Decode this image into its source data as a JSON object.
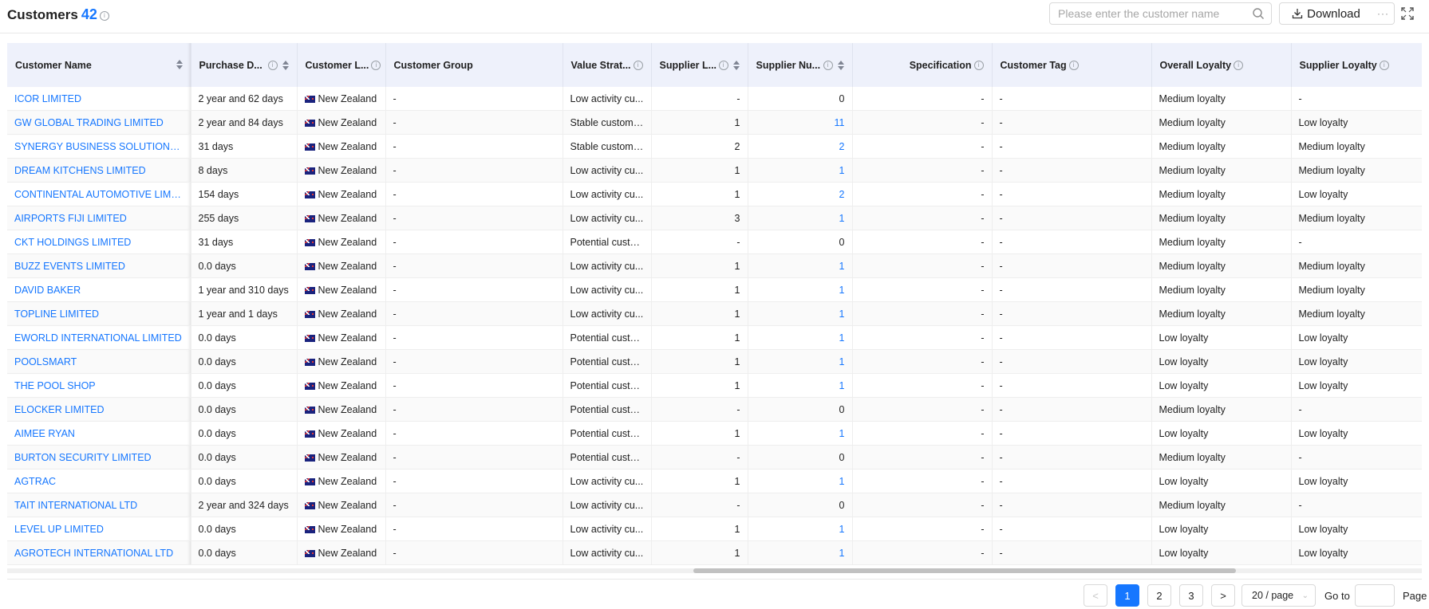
{
  "header": {
    "title": "Customers",
    "count": "42",
    "info_icon": "info-icon",
    "search_placeholder": "Please enter the customer name",
    "download_label": "Download",
    "more_label": "···"
  },
  "columns": [
    {
      "label": "Customer Name",
      "sortable": true,
      "info": false
    },
    {
      "label": "Purchase D...",
      "sortable": true,
      "info": true
    },
    {
      "label": "Customer L...",
      "sortable": false,
      "info": true
    },
    {
      "label": "Customer Group",
      "sortable": false,
      "info": false
    },
    {
      "label": "Value Strat...",
      "sortable": false,
      "info": true
    },
    {
      "label": "Supplier L...",
      "sortable": true,
      "info": true
    },
    {
      "label": "Supplier Nu...",
      "sortable": true,
      "info": true
    },
    {
      "label": "Specification",
      "sortable": false,
      "info": true
    },
    {
      "label": "Customer Tag",
      "sortable": false,
      "info": true
    },
    {
      "label": "Overall Loyalty",
      "sortable": false,
      "info": true
    },
    {
      "label": "Supplier Loyalty",
      "sortable": false,
      "info": true
    }
  ],
  "rows": [
    {
      "name": "ICOR LIMITED",
      "purchase": "2 year and 62 days",
      "location": "New Zealand",
      "group": "-",
      "value": "Low activity cu...",
      "sup_l": "-",
      "sup_n": "0",
      "spec": "-",
      "tag": "-",
      "overall": "Medium loyalty",
      "supplier_loyalty": "-"
    },
    {
      "name": "GW GLOBAL TRADING LIMITED",
      "purchase": "2 year and 84 days",
      "location": "New Zealand",
      "group": "-",
      "value": "Stable customers",
      "sup_l": "1",
      "sup_n": "11",
      "spec": "-",
      "tag": "-",
      "overall": "Medium loyalty",
      "supplier_loyalty": "Low loyalty"
    },
    {
      "name": "SYNERGY BUSINESS SOLUTIONS LIM...",
      "purchase": "31 days",
      "location": "New Zealand",
      "group": "-",
      "value": "Stable customers",
      "sup_l": "2",
      "sup_n": "2",
      "spec": "-",
      "tag": "-",
      "overall": "Medium loyalty",
      "supplier_loyalty": "Medium loyalty"
    },
    {
      "name": "DREAM KITCHENS LIMITED",
      "purchase": "8 days",
      "location": "New Zealand",
      "group": "-",
      "value": "Low activity cu...",
      "sup_l": "1",
      "sup_n": "1",
      "spec": "-",
      "tag": "-",
      "overall": "Medium loyalty",
      "supplier_loyalty": "Medium loyalty"
    },
    {
      "name": "CONTINENTAL AUTOMOTIVE LIMITED",
      "purchase": "154 days",
      "location": "New Zealand",
      "group": "-",
      "value": "Low activity cu...",
      "sup_l": "1",
      "sup_n": "2",
      "spec": "-",
      "tag": "-",
      "overall": "Medium loyalty",
      "supplier_loyalty": "Low loyalty"
    },
    {
      "name": "AIRPORTS FIJI LIMITED",
      "purchase": "255 days",
      "location": "New Zealand",
      "group": "-",
      "value": "Low activity cu...",
      "sup_l": "3",
      "sup_n": "1",
      "spec": "-",
      "tag": "-",
      "overall": "Medium loyalty",
      "supplier_loyalty": "Medium loyalty"
    },
    {
      "name": "CKT HOLDINGS LIMITED",
      "purchase": "31 days",
      "location": "New Zealand",
      "group": "-",
      "value": "Potential custo...",
      "sup_l": "-",
      "sup_n": "0",
      "spec": "-",
      "tag": "-",
      "overall": "Medium loyalty",
      "supplier_loyalty": "-"
    },
    {
      "name": "BUZZ EVENTS LIMITED",
      "purchase": "0.0 days",
      "location": "New Zealand",
      "group": "-",
      "value": "Low activity cu...",
      "sup_l": "1",
      "sup_n": "1",
      "spec": "-",
      "tag": "-",
      "overall": "Medium loyalty",
      "supplier_loyalty": "Medium loyalty"
    },
    {
      "name": "DAVID BAKER",
      "purchase": "1 year and 310 days",
      "location": "New Zealand",
      "group": "-",
      "value": "Low activity cu...",
      "sup_l": "1",
      "sup_n": "1",
      "spec": "-",
      "tag": "-",
      "overall": "Medium loyalty",
      "supplier_loyalty": "Medium loyalty"
    },
    {
      "name": "TOPLINE LIMITED",
      "purchase": "1 year and 1 days",
      "location": "New Zealand",
      "group": "-",
      "value": "Low activity cu...",
      "sup_l": "1",
      "sup_n": "1",
      "spec": "-",
      "tag": "-",
      "overall": "Medium loyalty",
      "supplier_loyalty": "Medium loyalty"
    },
    {
      "name": "EWORLD INTERNATIONAL LIMITED",
      "purchase": "0.0 days",
      "location": "New Zealand",
      "group": "-",
      "value": "Potential custo...",
      "sup_l": "1",
      "sup_n": "1",
      "spec": "-",
      "tag": "-",
      "overall": "Low loyalty",
      "supplier_loyalty": "Low loyalty"
    },
    {
      "name": "POOLSMART",
      "purchase": "0.0 days",
      "location": "New Zealand",
      "group": "-",
      "value": "Potential custo...",
      "sup_l": "1",
      "sup_n": "1",
      "spec": "-",
      "tag": "-",
      "overall": "Low loyalty",
      "supplier_loyalty": "Low loyalty"
    },
    {
      "name": "THE POOL SHOP",
      "purchase": "0.0 days",
      "location": "New Zealand",
      "group": "-",
      "value": "Potential custo...",
      "sup_l": "1",
      "sup_n": "1",
      "spec": "-",
      "tag": "-",
      "overall": "Low loyalty",
      "supplier_loyalty": "Low loyalty"
    },
    {
      "name": "ELOCKER LIMITED",
      "purchase": "0.0 days",
      "location": "New Zealand",
      "group": "-",
      "value": "Potential custo...",
      "sup_l": "-",
      "sup_n": "0",
      "spec": "-",
      "tag": "-",
      "overall": "Medium loyalty",
      "supplier_loyalty": "-"
    },
    {
      "name": "AIMEE RYAN",
      "purchase": "0.0 days",
      "location": "New Zealand",
      "group": "-",
      "value": "Potential custo...",
      "sup_l": "1",
      "sup_n": "1",
      "spec": "-",
      "tag": "-",
      "overall": "Low loyalty",
      "supplier_loyalty": "Low loyalty"
    },
    {
      "name": "BURTON SECURITY LIMITED",
      "purchase": "0.0 days",
      "location": "New Zealand",
      "group": "-",
      "value": "Potential custo...",
      "sup_l": "-",
      "sup_n": "0",
      "spec": "-",
      "tag": "-",
      "overall": "Medium loyalty",
      "supplier_loyalty": "-"
    },
    {
      "name": "AGTRAC",
      "purchase": "0.0 days",
      "location": "New Zealand",
      "group": "-",
      "value": "Low activity cu...",
      "sup_l": "1",
      "sup_n": "1",
      "spec": "-",
      "tag": "-",
      "overall": "Low loyalty",
      "supplier_loyalty": "Low loyalty"
    },
    {
      "name": "TAIT INTERNATIONAL LTD",
      "purchase": "2 year and 324 days",
      "location": "New Zealand",
      "group": "-",
      "value": "Low activity cu...",
      "sup_l": "-",
      "sup_n": "0",
      "spec": "-",
      "tag": "-",
      "overall": "Medium loyalty",
      "supplier_loyalty": "-"
    },
    {
      "name": "LEVEL UP LIMITED",
      "purchase": "0.0 days",
      "location": "New Zealand",
      "group": "-",
      "value": "Low activity cu...",
      "sup_l": "1",
      "sup_n": "1",
      "spec": "-",
      "tag": "-",
      "overall": "Low loyalty",
      "supplier_loyalty": "Low loyalty"
    },
    {
      "name": "AGROTECH INTERNATIONAL LTD",
      "purchase": "0.0 days",
      "location": "New Zealand",
      "group": "-",
      "value": "Low activity cu...",
      "sup_l": "1",
      "sup_n": "1",
      "spec": "-",
      "tag": "-",
      "overall": "Low loyalty",
      "supplier_loyalty": "Low loyalty"
    }
  ],
  "pagination": {
    "prev": "<",
    "pages": [
      "1",
      "2",
      "3"
    ],
    "current": "1",
    "next": ">",
    "page_size": "20 / page",
    "goto_label": "Go to",
    "page_label": "Page"
  },
  "colors": {
    "accent": "#1677ff",
    "header_bg": "#eef1fb"
  }
}
